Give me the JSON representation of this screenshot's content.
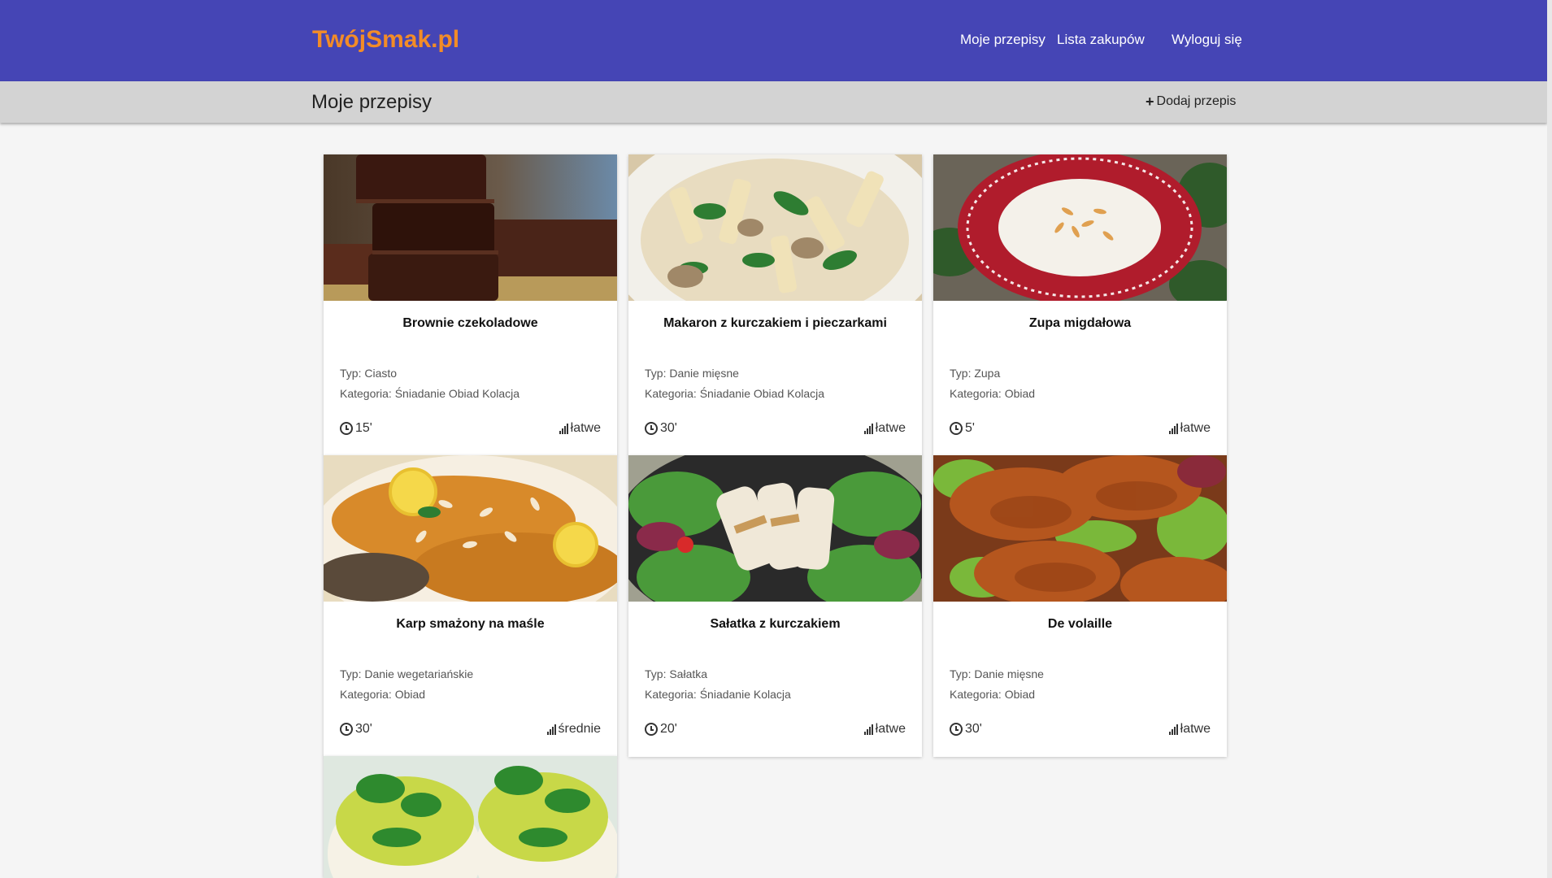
{
  "header": {
    "brand": "TwójSmak.pl",
    "nav": {
      "my_recipes": "Moje przepisy",
      "shopping_list": "Lista zakupów",
      "logout": "Wyloguj się"
    }
  },
  "subheader": {
    "title": "Moje przepisy",
    "add_label": "Dodaj przepis"
  },
  "recipes": [
    {
      "title": "Brownie czekoladowe",
      "type": "Typ: Ciasto",
      "category": "Kategoria: Śniadanie Obiad Kolacja",
      "time": "15'",
      "difficulty": "łatwe"
    },
    {
      "title": "Makaron z kurczakiem i pieczarkami",
      "type": "Typ: Danie mięsne",
      "category": "Kategoria: Śniadanie Obiad Kolacja",
      "time": "30'",
      "difficulty": "łatwe"
    },
    {
      "title": "Zupa migdałowa",
      "type": "Typ: Zupa",
      "category": "Kategoria: Obiad",
      "time": "5'",
      "difficulty": "łatwe"
    },
    {
      "title": "Karp smażony na maśle",
      "type": "Typ: Danie wegetariańskie",
      "category": "Kategoria: Obiad",
      "time": "30'",
      "difficulty": "średnie"
    },
    {
      "title": "Sałatka z kurczakiem",
      "type": "Typ: Sałatka",
      "category": "Kategoria: Śniadanie Kolacja",
      "time": "20'",
      "difficulty": "łatwe"
    },
    {
      "title": "De volaille",
      "type": "Typ: Danie mięsne",
      "category": "Kategoria: Obiad",
      "time": "30'",
      "difficulty": "łatwe"
    }
  ]
}
